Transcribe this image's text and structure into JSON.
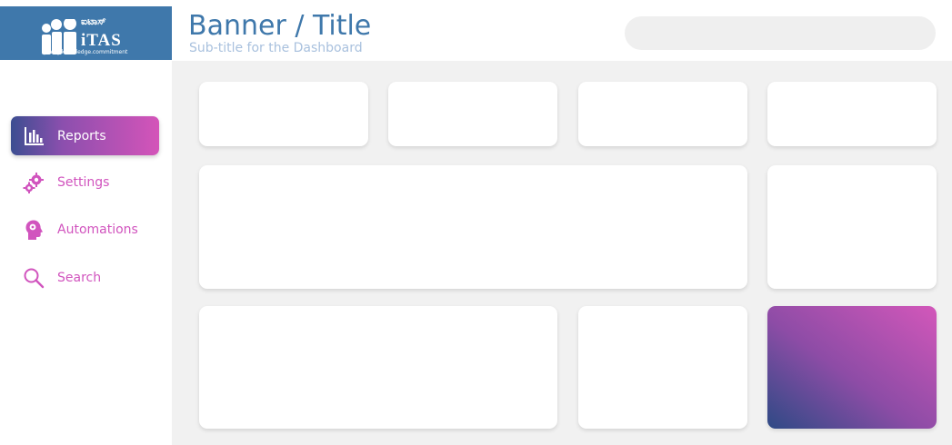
{
  "logo": {
    "script_text": "ಐಟಾಸ್",
    "brand": "iTAS",
    "tagline": "quality.knowledge.commitment"
  },
  "banner": {
    "title": "Banner / Title",
    "subtitle": "Sub-title for the Dashboard"
  },
  "search": {
    "placeholder": ""
  },
  "sidebar": {
    "items": [
      {
        "label": "Reports",
        "icon": "bar-chart-icon",
        "active": true
      },
      {
        "label": "Settings",
        "icon": "gears-icon",
        "active": false
      },
      {
        "label": "Automations",
        "icon": "head-gear-icon",
        "active": false
      },
      {
        "label": "Search",
        "icon": "magnifier-icon",
        "active": false
      }
    ]
  },
  "colors": {
    "brand_blue": "#3f78ab",
    "accent_pink": "#d154be",
    "subtitle": "#a9c1de",
    "content_bg": "#f1f1f1",
    "gradient_start": "#2e4a85",
    "gradient_end": "#d357ba"
  }
}
